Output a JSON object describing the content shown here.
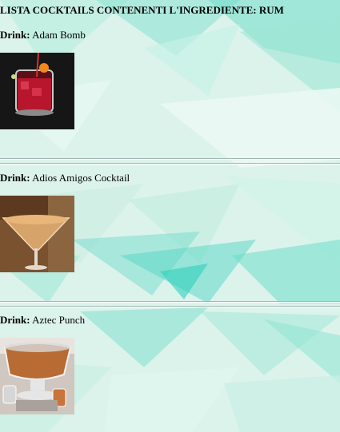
{
  "page": {
    "title": "LISTA COCKTAILS CONTENENTI L'INGREDIENTE: RUM"
  },
  "drinks": [
    {
      "prefix": "Drink:",
      "name": "Adam Bomb",
      "image_icon": "cocktail-photo-red-rocks-glass"
    },
    {
      "prefix": "Drink:",
      "name": "Adios Amigos Cocktail",
      "image_icon": "cocktail-photo-martini-glass"
    },
    {
      "prefix": "Drink:",
      "name": "Aztec Punch",
      "image_icon": "cocktail-photo-punch-bowl"
    }
  ],
  "colors": {
    "background": "#d8f1ea",
    "accent_teal": "#3fd3c4"
  }
}
